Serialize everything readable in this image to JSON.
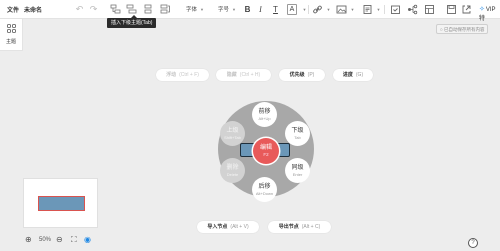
{
  "menu": {
    "file": "文件",
    "title": "未命名"
  },
  "toolbar": {
    "undo_icon": "undo-icon",
    "redo_icon": "redo-icon",
    "font_select": "字体",
    "size_select": "字号",
    "bold": "B",
    "italic": "I",
    "underline": "T",
    "font_color": "A",
    "vip": "VIP特"
  },
  "tooltip": "插入下级主题(Tab)",
  "theme_panel": {
    "label": "主题"
  },
  "autosave": "已自动保存所有内容",
  "pills": {
    "float": {
      "label": "浮动",
      "shortcut": "(Ctrl + F)"
    },
    "hide": {
      "label": "隐藏",
      "shortcut": "(Ctrl + H)"
    },
    "priority": {
      "label": "优先级",
      "shortcut": "(P)"
    },
    "progress": {
      "label": "进度",
      "shortcut": "(G)"
    },
    "import": {
      "label": "导入节点",
      "shortcut": "(Alt + V)"
    },
    "export": {
      "label": "导出节点",
      "shortcut": "(Alt + C)"
    }
  },
  "radial": {
    "up": {
      "label": "前移",
      "hint": "Alt+Up"
    },
    "upper_level": {
      "label": "上级",
      "hint": "Shift+Tab"
    },
    "lower_level": {
      "label": "下级",
      "hint": "Tab"
    },
    "delete": {
      "label": "删除",
      "hint": "Delete"
    },
    "sibling": {
      "label": "同级",
      "hint": "Enter"
    },
    "down": {
      "label": "后移",
      "hint": "Alt+Down"
    },
    "edit": {
      "label": "编辑",
      "hint": "F2"
    }
  },
  "zoom": {
    "level": "50%"
  },
  "colors": {
    "node_fill": "#6b97b8",
    "edit_accent": "#e85a5a",
    "ring": "#a8a8a8",
    "link_blue": "#1e88e5"
  }
}
